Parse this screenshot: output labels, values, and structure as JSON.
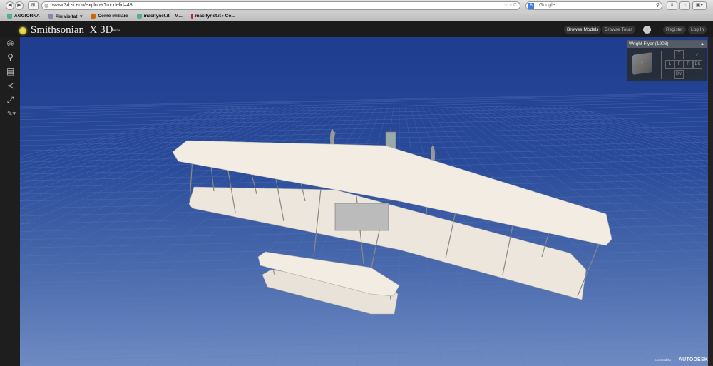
{
  "browser": {
    "url": "www.3d.si.edu/explorer?modelid=48",
    "search_placeholder": "Google",
    "bookmarks": [
      {
        "label": "AGGIORNA",
        "color": "#5a9"
      },
      {
        "label": "Più visitati ▾",
        "color": "#88a"
      },
      {
        "label": "Come iniziare",
        "color": "#c60"
      },
      {
        "label": "macitynet.it – M...",
        "color": "#5a9"
      },
      {
        "label": "macitynet.it › Co...",
        "color": "#c22"
      }
    ]
  },
  "header": {
    "logo": "Smithsonian",
    "product": "X 3D",
    "beta": "BETA",
    "nav": [
      "Browse Models",
      "Browse Tours"
    ],
    "info": "i",
    "register": "Register",
    "login": "Log In"
  },
  "viewer": {
    "model_title": "Wright Flyer (1903)",
    "cube_face": "F",
    "views": [
      "T",
      "L",
      "F",
      "R",
      "BK",
      "BM"
    ]
  },
  "footer": {
    "powered_by": "powered by",
    "brand": "AUTODESK"
  }
}
